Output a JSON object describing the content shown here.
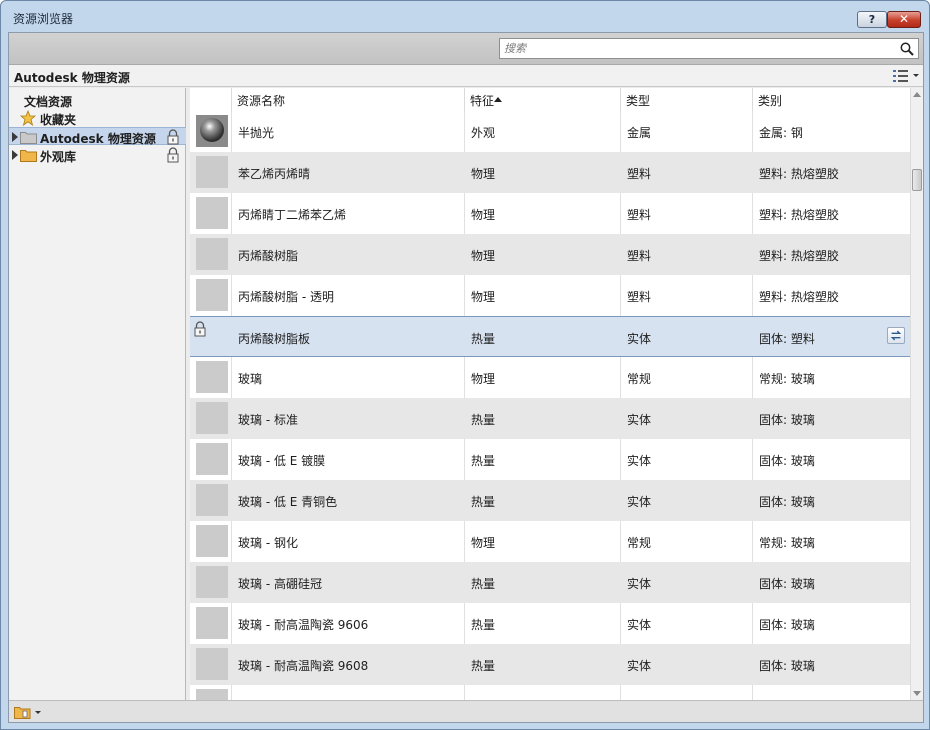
{
  "window": {
    "title": "资源浏览器",
    "help_label": "?",
    "close_label": "✕"
  },
  "search": {
    "placeholder": "搜索"
  },
  "library_header": {
    "title": "Autodesk 物理资源"
  },
  "tree": {
    "doc_assets": "文档资源",
    "favorites": "收藏夹",
    "autodesk_physical": "Autodesk 物理资源",
    "appearance_library": "外观库"
  },
  "table": {
    "columns": [
      "资源名称",
      "特征",
      "类型",
      "类别"
    ],
    "rows": [
      {
        "name": "半抛光",
        "feature": "外观",
        "type": "金属",
        "category": "金属: 钢"
      },
      {
        "name": "苯乙烯丙烯晴",
        "feature": "物理",
        "type": "塑料",
        "category": "塑料: 热熔塑胶"
      },
      {
        "name": "丙烯睛丁二烯苯乙烯",
        "feature": "物理",
        "type": "塑料",
        "category": "塑料: 热熔塑胶"
      },
      {
        "name": "丙烯酸树脂",
        "feature": "物理",
        "type": "塑料",
        "category": "塑料: 热熔塑胶"
      },
      {
        "name": "丙烯酸树脂 - 透明",
        "feature": "物理",
        "type": "塑料",
        "category": "塑料: 热熔塑胶"
      },
      {
        "name": "丙烯酸树脂板",
        "feature": "热量",
        "type": "实体",
        "category": "固体: 塑料"
      },
      {
        "name": "玻璃",
        "feature": "物理",
        "type": "常规",
        "category": "常规: 玻璃"
      },
      {
        "name": "玻璃 - 标准",
        "feature": "热量",
        "type": "实体",
        "category": "固体: 玻璃"
      },
      {
        "name": "玻璃 - 低 E 镀膜",
        "feature": "热量",
        "type": "实体",
        "category": "固体: 玻璃"
      },
      {
        "name": "玻璃 - 低 E 青铜色",
        "feature": "热量",
        "type": "实体",
        "category": "固体: 玻璃"
      },
      {
        "name": "玻璃 - 钢化",
        "feature": "物理",
        "type": "常规",
        "category": "常规: 玻璃"
      },
      {
        "name": "玻璃 - 高硼硅冠",
        "feature": "热量",
        "type": "实体",
        "category": "固体: 玻璃"
      },
      {
        "name": "玻璃 - 耐高温陶瓷 9606",
        "feature": "热量",
        "type": "实体",
        "category": "固体: 玻璃"
      },
      {
        "name": "玻璃 - 耐高温陶瓷 9608",
        "feature": "热量",
        "type": "实体",
        "category": "固体: 玻璃"
      },
      {
        "name": "",
        "feature": "",
        "type": "",
        "category": ""
      }
    ]
  },
  "colors": {
    "selection": "#d7e2f1",
    "alt_row": "#e7e7e7",
    "folder": "#f1b64a"
  },
  "icons": [
    "help-icon",
    "close-icon",
    "search-icon",
    "view-list-icon",
    "star-icon",
    "folder-icon",
    "lock-icon",
    "sphere-thumbnail-icon",
    "swap-icon",
    "library-icon"
  ]
}
